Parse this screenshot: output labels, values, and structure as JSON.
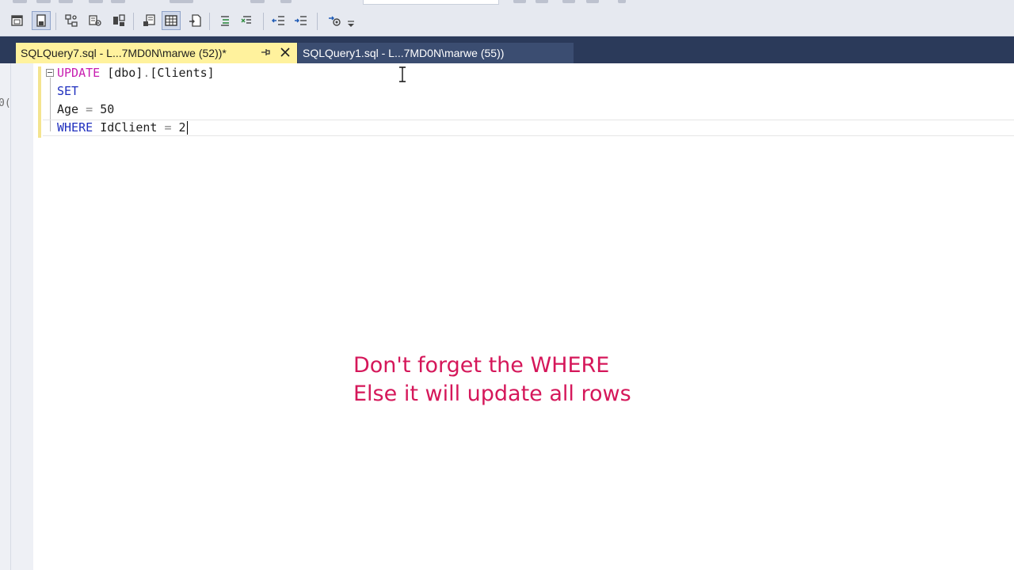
{
  "colors": {
    "toolbar_bg": "#e6e9f0",
    "tab_well_bg": "#2b3a5a",
    "active_tab_bg": "#fff29d",
    "inactive_tab_bg": "#3b4d71",
    "keyword_pink": "#c81eb0",
    "keyword_blue": "#1f2fbe",
    "annotation_text": "#d5175a"
  },
  "toolbar": {
    "icons": [
      "new-window-icon",
      "save-icon",
      "relationships-icon",
      "query-options-icon",
      "results-to-text-icon",
      "results-to-grid-icon",
      "results-to-file-icon",
      "comment-icon",
      "uncomment-icon",
      "decrease-indent-icon",
      "increase-indent-icon",
      "specify-values-icon",
      "toolbar-overflow-icon"
    ]
  },
  "tabs": [
    {
      "label": "SQLQuery7.sql - L...7MD0N\\marwe (52))*",
      "active": true
    },
    {
      "label": "SQLQuery1.sql - L...7MD0N\\marwe (55))",
      "active": false
    }
  ],
  "editor": {
    "left_strip_glyph": "0(",
    "lines": [
      {
        "keyword": "UPDATE",
        "rest_table": "[dbo]",
        "dot": ".",
        "rest_table2": "[Clients]"
      },
      {
        "keyword": "SET"
      },
      {
        "column": "Age",
        "op": "=",
        "value": "50"
      },
      {
        "keyword": "WHERE",
        "column": "IdClient",
        "op": "=",
        "value": "2"
      }
    ]
  },
  "annotation": {
    "line1": "Don't forget the WHERE",
    "line2": "Else it will update all rows"
  }
}
